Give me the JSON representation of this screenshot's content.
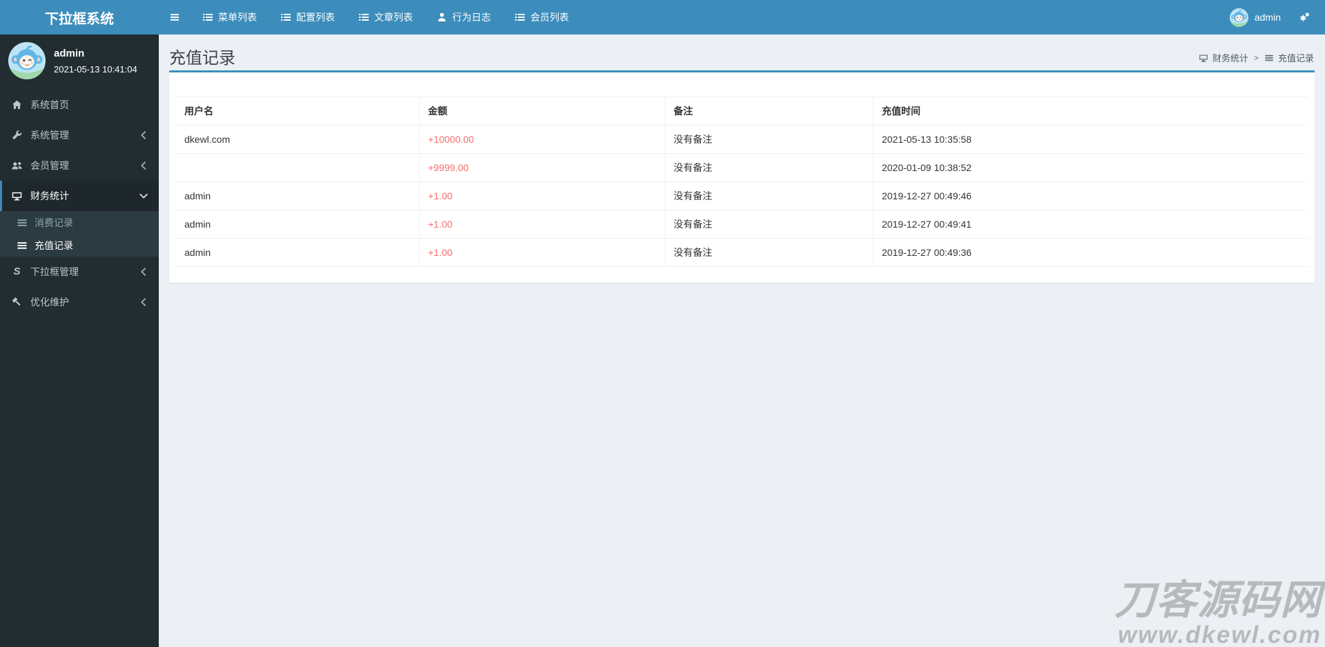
{
  "app": {
    "title": "下拉框系统"
  },
  "colors": {
    "accent": "#3c8dbc",
    "sidebar": "#222d32",
    "sidebar_active": "#1e282c",
    "submenu": "#2c3b41",
    "content_bg": "#ecf0f5",
    "amount_red": "#f56c6c"
  },
  "navbar": {
    "items": [
      {
        "label": "菜单列表",
        "icon": "list-icon"
      },
      {
        "label": "配置列表",
        "icon": "list-icon"
      },
      {
        "label": "文章列表",
        "icon": "list-icon"
      },
      {
        "label": "行为日志",
        "icon": "person-icon"
      },
      {
        "label": "会员列表",
        "icon": "list-icon"
      }
    ],
    "user": {
      "name": "admin"
    }
  },
  "sidebar": {
    "user": {
      "name": "admin",
      "time": "2021-05-13 10:41:04"
    },
    "menu": [
      {
        "label": "系统首页",
        "icon": "home-icon"
      },
      {
        "label": "系统管理",
        "icon": "wrench-icon",
        "chevron": "left"
      },
      {
        "label": "会员管理",
        "icon": "users-icon",
        "chevron": "left"
      },
      {
        "label": "财务统计",
        "icon": "desktop-icon",
        "chevron": "down",
        "active": true,
        "children": [
          {
            "label": "消费记录",
            "icon": "lines-icon",
            "state": "muted"
          },
          {
            "label": "充值记录",
            "icon": "lines-icon",
            "state": "current"
          }
        ]
      },
      {
        "label": "下拉框管理",
        "icon": "s-icon",
        "chevron": "left"
      },
      {
        "label": "优化维护",
        "icon": "gavel-icon",
        "chevron": "left"
      }
    ]
  },
  "content": {
    "title": "充值记录",
    "breadcrumb": {
      "items": [
        {
          "label": "财务统计",
          "icon": "desktop-icon"
        },
        {
          "label": "充值记录",
          "icon": "lines-icon"
        }
      ],
      "separator": ">"
    }
  },
  "table": {
    "columns": [
      "用户名",
      "金额",
      "备注",
      "充值时间"
    ],
    "rows": [
      {
        "username": "dkewl.com",
        "amount": "+10000.00",
        "note": "没有备注",
        "time": "2021-05-13 10:35:58"
      },
      {
        "username": "",
        "amount": "+9999.00",
        "note": "没有备注",
        "time": "2020-01-09 10:38:52"
      },
      {
        "username": "admin",
        "amount": "+1.00",
        "note": "没有备注",
        "time": "2019-12-27 00:49:46"
      },
      {
        "username": "admin",
        "amount": "+1.00",
        "note": "没有备注",
        "time": "2019-12-27 00:49:41"
      },
      {
        "username": "admin",
        "amount": "+1.00",
        "note": "没有备注",
        "time": "2019-12-27 00:49:36"
      }
    ]
  },
  "watermark": {
    "line1": "刀客源码网",
    "line2": "www.dkewl.com"
  }
}
